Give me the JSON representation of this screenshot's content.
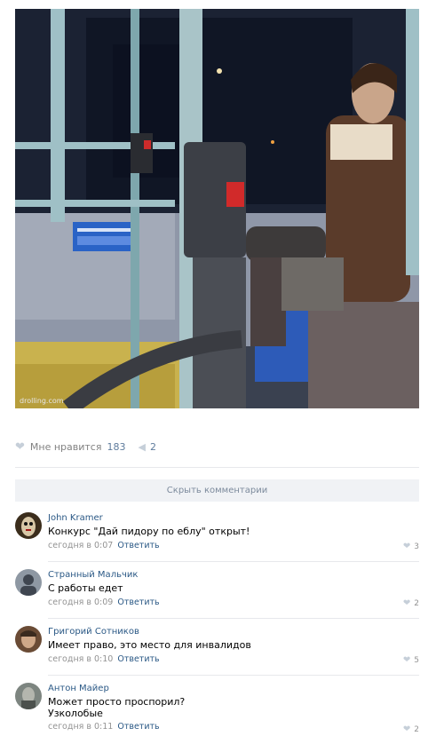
{
  "post": {
    "watermark": "drolling.com",
    "likes_label": "Мне нравится",
    "likes_count": "183",
    "shares_count": "2",
    "hide_comments": "Скрыть комментарии"
  },
  "comments": [
    {
      "author": "John Kramer",
      "text": "Конкурс \"Дай пидору по еблу\" открыт!",
      "text2": "",
      "time": "сегодня в 0:07",
      "reply": "Ответить",
      "likes": "3"
    },
    {
      "author": "Странный Мальчик",
      "text": "С работы едет",
      "text2": "",
      "time": "сегодня в 0:09",
      "reply": "Ответить",
      "likes": "2"
    },
    {
      "author": "Григорий Сотников",
      "text": "Имеет право, это место для инвалидов",
      "text2": "",
      "time": "сегодня в 0:10",
      "reply": "Ответить",
      "likes": "5"
    },
    {
      "author": "Антон Майер",
      "text": "Может просто проспорил?",
      "text2": "Узколобые",
      "time": "сегодня в 0:11",
      "reply": "Ответить",
      "likes": "2"
    }
  ],
  "colors": {
    "link": "#2a5885",
    "muted": "#939393",
    "bar": "#f0f2f5"
  },
  "icons": {
    "like": "heart-icon",
    "share": "share-icon"
  }
}
